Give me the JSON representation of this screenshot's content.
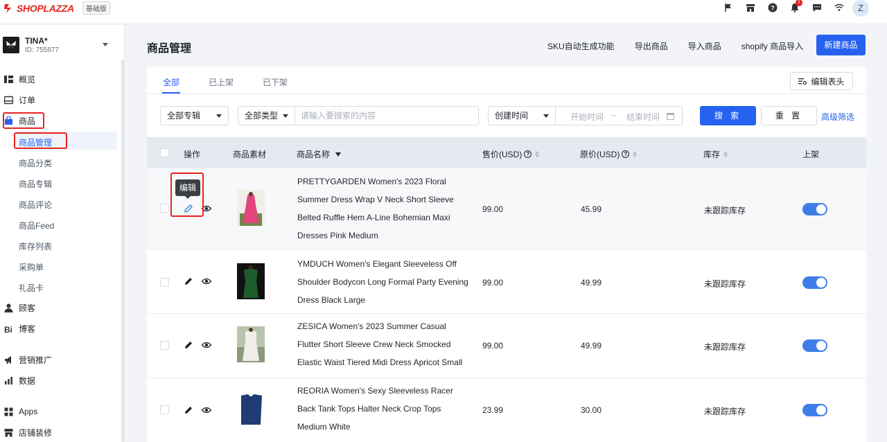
{
  "topbar": {
    "brand": "SHOPLAZZA",
    "plan": "基础版",
    "notification_count": "1",
    "avatar_initial": "Z",
    "icons": [
      "flag-icon",
      "store-icon",
      "help-icon",
      "bell-icon",
      "message-icon",
      "wifi-icon"
    ]
  },
  "store": {
    "name": "TINA*",
    "id": "ID: 755877"
  },
  "sidebar": {
    "items": [
      {
        "label": "概览",
        "icon": "overview-icon"
      },
      {
        "label": "订单",
        "icon": "orders-icon"
      },
      {
        "label": "商品",
        "icon": "products-icon"
      },
      {
        "label": "顾客",
        "icon": "customers-icon"
      },
      {
        "label": "博客",
        "icon": "blog-icon"
      },
      {
        "label": "营销推广",
        "icon": "marketing-icon"
      },
      {
        "label": "数据",
        "icon": "data-icon"
      },
      {
        "label": "Apps",
        "icon": "apps-icon"
      },
      {
        "label": "店铺装修",
        "icon": "theme-icon"
      }
    ],
    "sub_items": [
      "商品管理",
      "商品分类",
      "商品专辑",
      "商品评论",
      "商品Feed",
      "库存列表",
      "采购单",
      "礼品卡"
    ]
  },
  "page": {
    "title": "商品管理",
    "actions": [
      "SKU自动生成功能",
      "导出商品",
      "导入商品",
      "shopify 商品导入"
    ],
    "new_button": "新建商品"
  },
  "tabs": [
    "全部",
    "已上架",
    "已下架"
  ],
  "edit_columns": "编辑表头",
  "filters": {
    "collection": "全部专辑",
    "type": "全部类型",
    "search_placeholder": "请输入要搜索的内容",
    "date_field": "创建时间",
    "start_placeholder": "开始时间",
    "range_sep": "~",
    "end_placeholder": "结束时间",
    "search_button": "搜 索",
    "reset_button": "重 置",
    "advanced": "高级筛选"
  },
  "table": {
    "headers": {
      "action": "操作",
      "media": "商品素材",
      "name": "商品名称",
      "price": "售价(USD)",
      "compare": "原价(USD)",
      "stock": "库存",
      "listed": "上架"
    },
    "tooltip": "编辑",
    "rows": [
      {
        "name": "PRETTYGARDEN Women's 2023 Floral Summer Dress Wrap V Neck Short Sleeve Belted Ruffle Hem A-Line Bohemian Maxi Dresses Pink Medium",
        "price": "99.00",
        "compare": "45.99",
        "stock": "未跟踪库存",
        "listed": true,
        "thumb_color": "#e0457b"
      },
      {
        "name": "YMDUCH Women's Elegant Sleeveless Off Shoulder Bodycon Long Formal Party Evening Dress Black Large",
        "price": "99.00",
        "compare": "49.99",
        "stock": "未跟踪库存",
        "listed": true,
        "thumb_color": "#1c5c2c"
      },
      {
        "name": "ZESICA Women's 2023 Summer Casual Flutter Short Sleeve Crew Neck Smocked Elastic Waist Tiered Midi Dress Apricot Small",
        "price": "99.00",
        "compare": "49.99",
        "stock": "未跟踪库存",
        "listed": true,
        "thumb_color": "#efeee9"
      },
      {
        "name": "REORIA Women's Sexy Sleeveless Racer Back Tank Tops Halter Neck Crop Tops Medium White",
        "price": "23.99",
        "compare": "30.00",
        "stock": "未跟踪库存",
        "listed": true,
        "thumb_color": "#1f3c73"
      }
    ]
  }
}
